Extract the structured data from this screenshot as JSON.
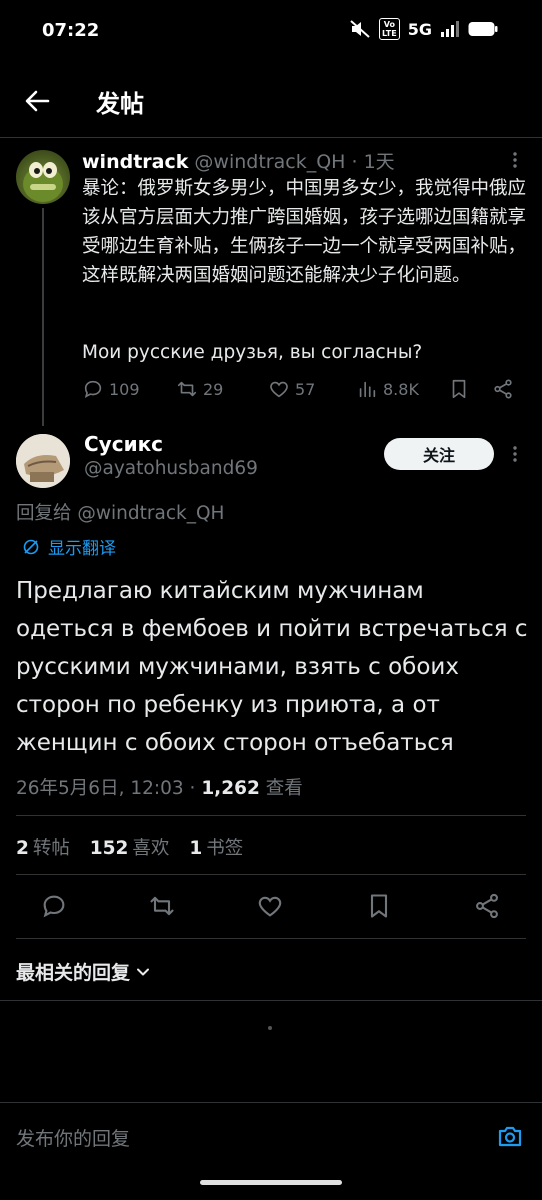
{
  "status_bar": {
    "time": "07:22",
    "volte": "Vo LTE",
    "network": "5G"
  },
  "header": {
    "title": "发帖"
  },
  "parent_post": {
    "author_name": "windtrack",
    "author_handle": "@windtrack_QH",
    "time_ago": "· 1天",
    "text": "暴论：俄罗斯女多男少，中国男多女少，我觉得中俄应该从官方层面大力推广跨国婚姻，孩子选哪边国籍就享受哪边生育补贴，生俩孩子一边一个就享受两国补贴，这样既解决两国婚姻问题还能解决少子化问题。",
    "text2": "Мои русские друзья, вы согласны?",
    "replies": "109",
    "reposts": "29",
    "likes": "57",
    "views": "8.8K"
  },
  "reply_post": {
    "author_name": "Сусикс",
    "author_handle": "@ayatohusband69",
    "follow_label": "关注",
    "reply_to": "回复给 @windtrack_QH",
    "translate_label": "显示翻译",
    "text": "Предлагаю китайским мужчинам одеться в фембоев и пойти встречаться с русскими мужчинами, взять с обоих сторон по ребенку из приюта, а от женщин с обоих сторон отъебаться",
    "timestamp": "26年5月6日, 12:03 · ",
    "view_count": "1,262",
    "view_label": " 查看",
    "reposts_count": "2",
    "reposts_label": "转帖",
    "likes_count": "152",
    "likes_label": "喜欢",
    "bookmarks_count": "1",
    "bookmarks_label": "书签"
  },
  "replies_section": {
    "sort_label": "最相关的回复"
  },
  "composer": {
    "placeholder": "发布你的回复"
  },
  "colors": {
    "background": "#000000",
    "text": "#e7e9ea",
    "secondary": "#71767b",
    "accent": "#1d9bf0",
    "divider": "#2f3336"
  }
}
